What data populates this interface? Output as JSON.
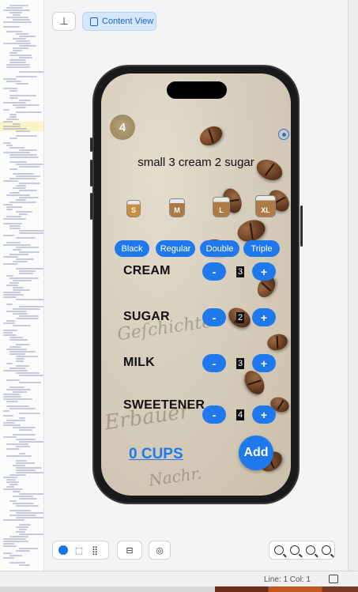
{
  "toolbar": {
    "pin_icon": "pin-icon",
    "content_view_label": "Content View"
  },
  "app": {
    "logo_text": "4",
    "order_summary": "small 3 cream 2 sugar",
    "sizes": [
      "S",
      "M",
      "L",
      "XL"
    ],
    "roast_options": [
      "Black",
      "Regular",
      "Double",
      "Triple"
    ],
    "rows": [
      {
        "label": "CREAM",
        "value": "3"
      },
      {
        "label": "SUGAR",
        "value": "2"
      },
      {
        "label": "MILK",
        "value": "3"
      },
      {
        "label": "SWEETENERS",
        "value": "4"
      }
    ],
    "minus_label": "-",
    "plus_label": "+",
    "cups_label": "0 CUPS",
    "add_label": "Add"
  },
  "statusbar": {
    "position": "Line: 1  Col: 1"
  },
  "colors": {
    "accent": "#1f78ec",
    "phone_frame": "#1a1a1a"
  }
}
